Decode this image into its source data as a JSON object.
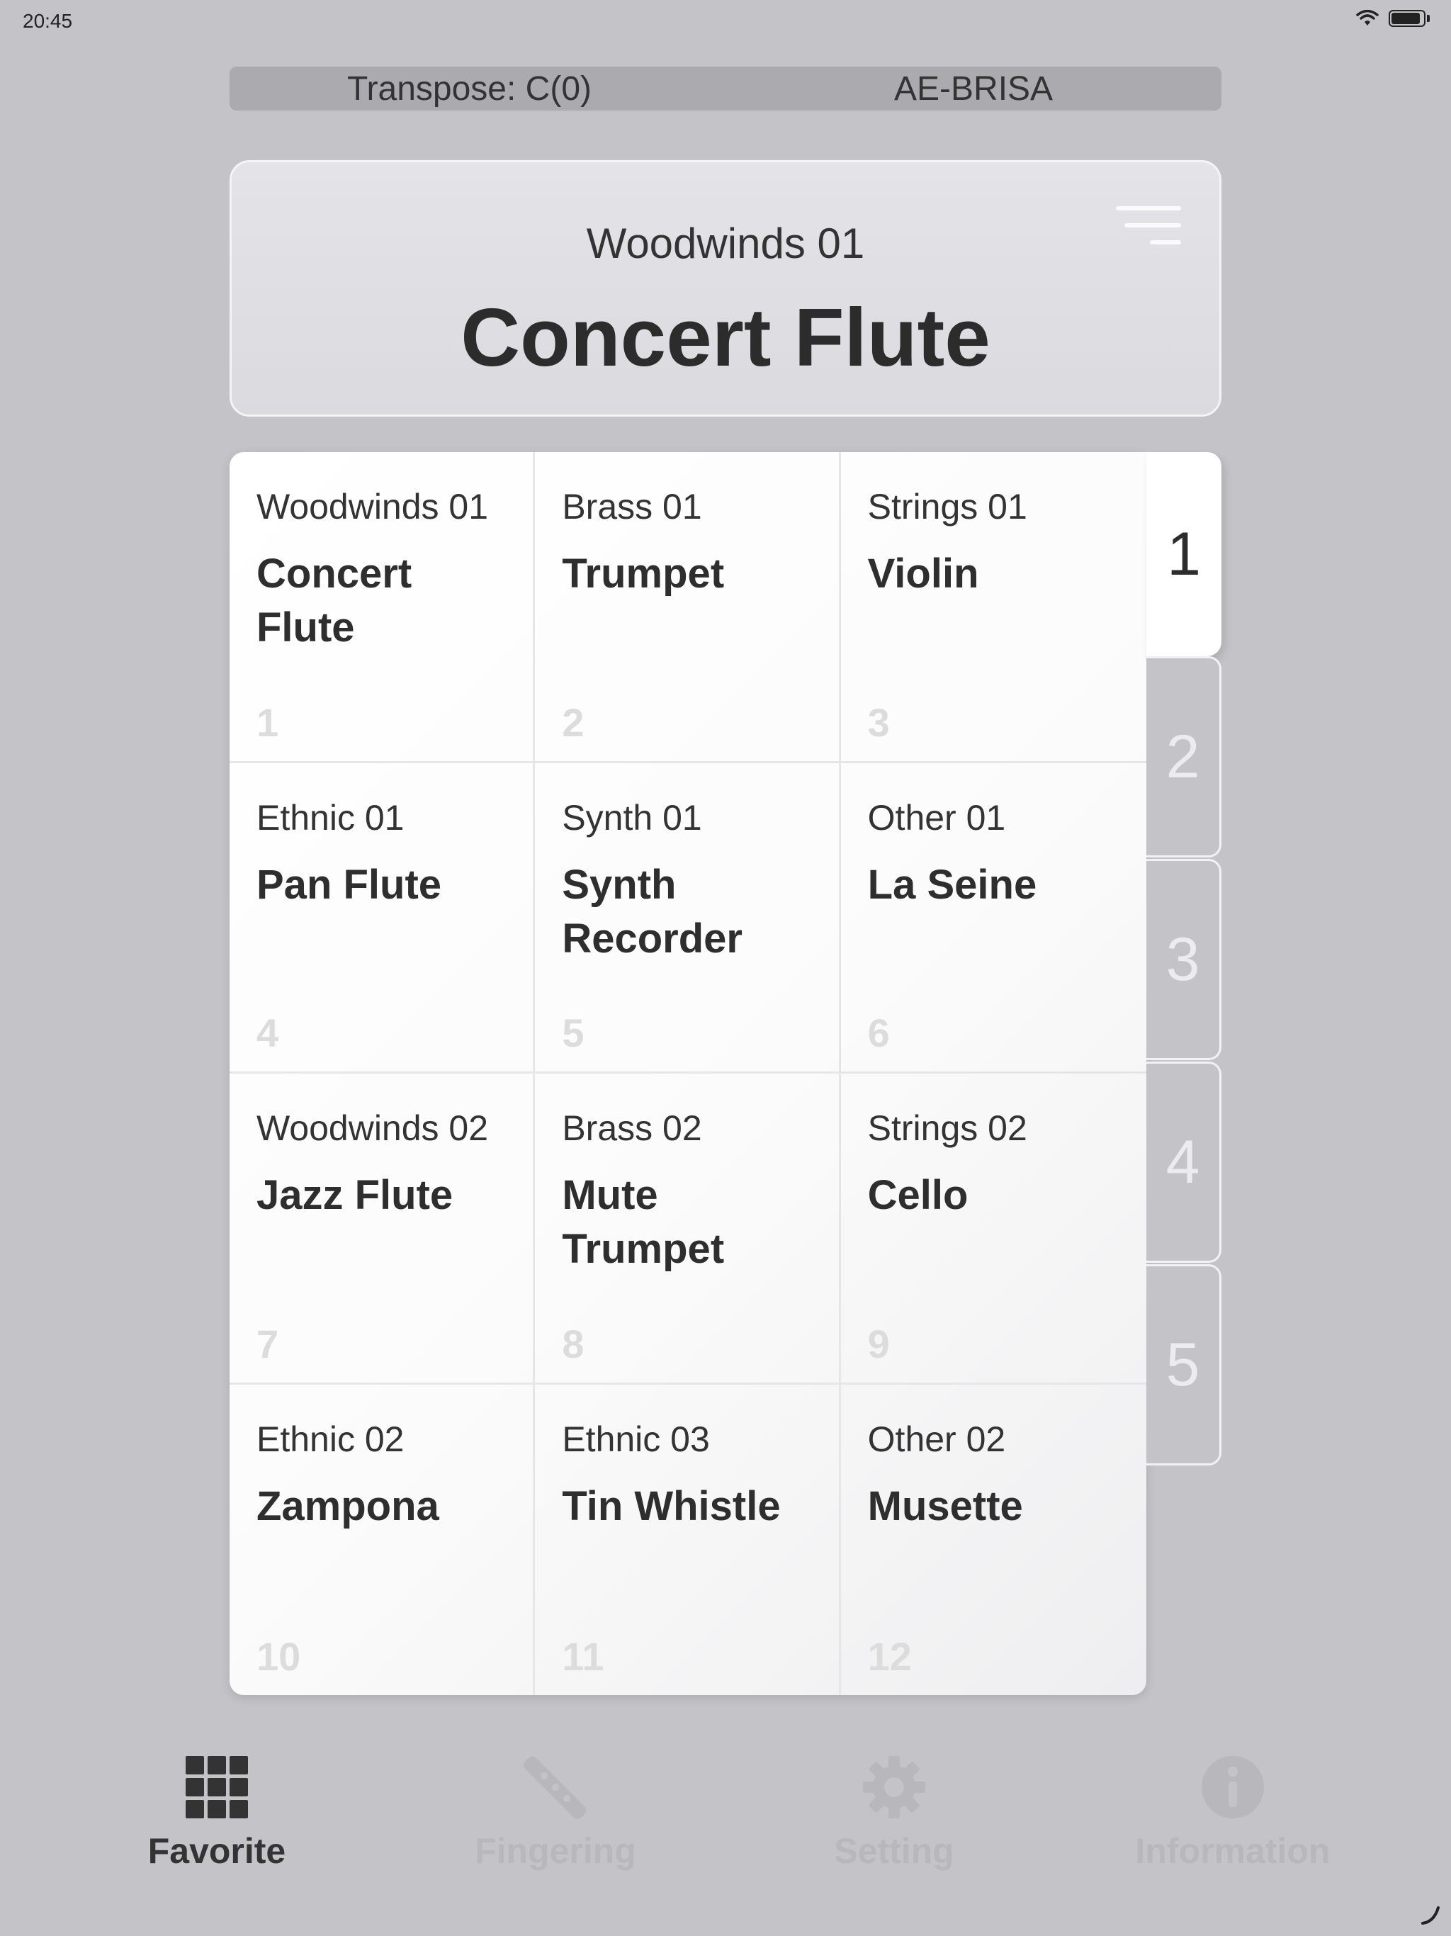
{
  "status_bar": {
    "time": "20:45"
  },
  "header": {
    "transpose": "Transpose: C(0)",
    "device": "AE-BRISA"
  },
  "current": {
    "category": "Woodwinds 01",
    "name": "Concert Flute"
  },
  "favorites": [
    {
      "category": "Woodwinds 01",
      "name": "Concert Flute",
      "number": "1"
    },
    {
      "category": "Brass 01",
      "name": "Trumpet",
      "number": "2"
    },
    {
      "category": "Strings 01",
      "name": "Violin",
      "number": "3"
    },
    {
      "category": "Ethnic 01",
      "name": "Pan Flute",
      "number": "4"
    },
    {
      "category": "Synth 01",
      "name": "Synth Recorder",
      "number": "5"
    },
    {
      "category": "Other 01",
      "name": "La Seine",
      "number": "6"
    },
    {
      "category": "Woodwinds 02",
      "name": "Jazz Flute",
      "number": "7"
    },
    {
      "category": "Brass 02",
      "name": "Mute Trumpet",
      "number": "8"
    },
    {
      "category": "Strings 02",
      "name": "Cello",
      "number": "9"
    },
    {
      "category": "Ethnic 02",
      "name": "Zampona",
      "number": "10"
    },
    {
      "category": "Ethnic 03",
      "name": "Tin Whistle",
      "number": "11"
    },
    {
      "category": "Other 02",
      "name": "Musette",
      "number": "12"
    }
  ],
  "pages": [
    {
      "label": "1",
      "active": true
    },
    {
      "label": "2",
      "active": false
    },
    {
      "label": "3",
      "active": false
    },
    {
      "label": "4",
      "active": false
    },
    {
      "label": "5",
      "active": false
    }
  ],
  "tabs": [
    {
      "label": "Favorite",
      "icon": "grid-icon",
      "active": true
    },
    {
      "label": "Fingering",
      "icon": "flute-icon",
      "active": false
    },
    {
      "label": "Setting",
      "icon": "gear-icon",
      "active": false
    },
    {
      "label": "Information",
      "icon": "info-icon",
      "active": false
    }
  ],
  "colors": {
    "background": "#c4c4c8",
    "active_text": "#333333",
    "inactive_tab": "#b8b8bc"
  }
}
